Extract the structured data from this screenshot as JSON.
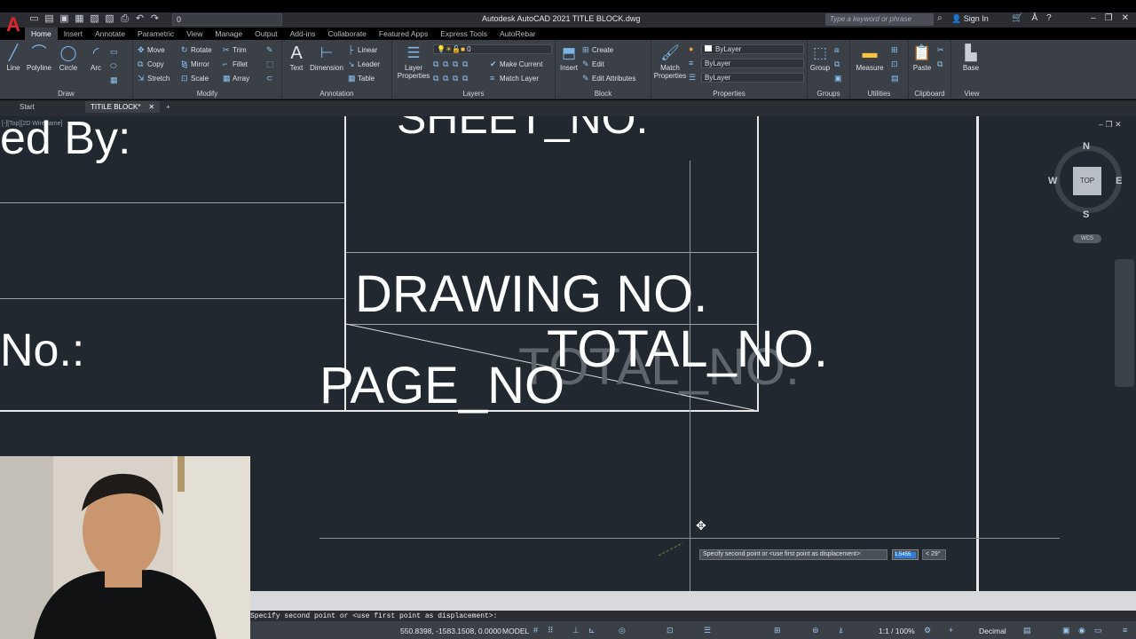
{
  "app": {
    "logo": "A",
    "title": "Autodesk AutoCAD 2021    TITLE BLOCK.dwg",
    "search_placeholder": "Type a keyword or phrase",
    "signin": "Sign In",
    "qat_layer": "0"
  },
  "ribbon_tabs": [
    "Home",
    "Insert",
    "Annotate",
    "Parametric",
    "View",
    "Manage",
    "Output",
    "Add-ins",
    "Collaborate",
    "Featured Apps",
    "Express Tools",
    "AutoRebar"
  ],
  "draw": {
    "title": "Draw",
    "line": "Line",
    "polyline": "Polyline",
    "circle": "Circle",
    "arc": "Arc"
  },
  "modify": {
    "title": "Modify",
    "move": "Move",
    "rotate": "Rotate",
    "trim": "Trim",
    "copy": "Copy",
    "mirror": "Mirror",
    "fillet": "Fillet",
    "stretch": "Stretch",
    "scale": "Scale",
    "array": "Array"
  },
  "annotation": {
    "title": "Annotation",
    "text": "Text",
    "dimension": "Dimension",
    "linear": "Linear",
    "leader": "Leader",
    "table": "Table"
  },
  "layers": {
    "title": "Layers",
    "layer_properties": "Layer Properties",
    "current_layer": "0",
    "make_current": "Make Current",
    "match_layer": "Match Layer"
  },
  "block": {
    "title": "Block",
    "insert": "Insert",
    "create": "Create",
    "edit": "Edit",
    "edit_attributes": "Edit Attributes"
  },
  "properties": {
    "title": "Properties",
    "match_properties": "Match Properties",
    "color": "ByLayer",
    "linetype": "ByLayer",
    "lineweight": "ByLayer"
  },
  "groups": {
    "title": "Groups",
    "group": "Group"
  },
  "utilities": {
    "title": "Utilities",
    "measure": "Measure"
  },
  "clipboard": {
    "title": "Clipboard",
    "paste": "Paste"
  },
  "view_panel": {
    "title": "View",
    "base": "Base"
  },
  "doc_tabs": {
    "start": "Start",
    "active": "TITILE BLOCK*",
    "add": "+"
  },
  "viewport_label": "[-][Top][2D Wireframe]",
  "drawing": {
    "sheet_no": "SHEET_NO.",
    "designed_by": "ed By:",
    "drawing_no": "DRAWING NO.",
    "no_label": "No.:",
    "total_no": "TOTAL_NO.",
    "total_no_ghost": "TOTAL_NO.",
    "page_no": "PAGE_NO"
  },
  "viewcube": {
    "top": "TOP",
    "n": "N",
    "s": "S",
    "e": "E",
    "w": "W",
    "wcs": "WCS"
  },
  "dynamic_input": {
    "prompt": "Specify second point or <use first point as displacement>:",
    "value": "1.5455",
    "angle": "< 29°"
  },
  "command_line": "Specify second point or <use first point as displacement>:",
  "status": {
    "coords": "550.8398, -1583.1508, 0.0000",
    "model": "MODEL",
    "scale": "1:1 / 100%",
    "units": "Decimal"
  }
}
